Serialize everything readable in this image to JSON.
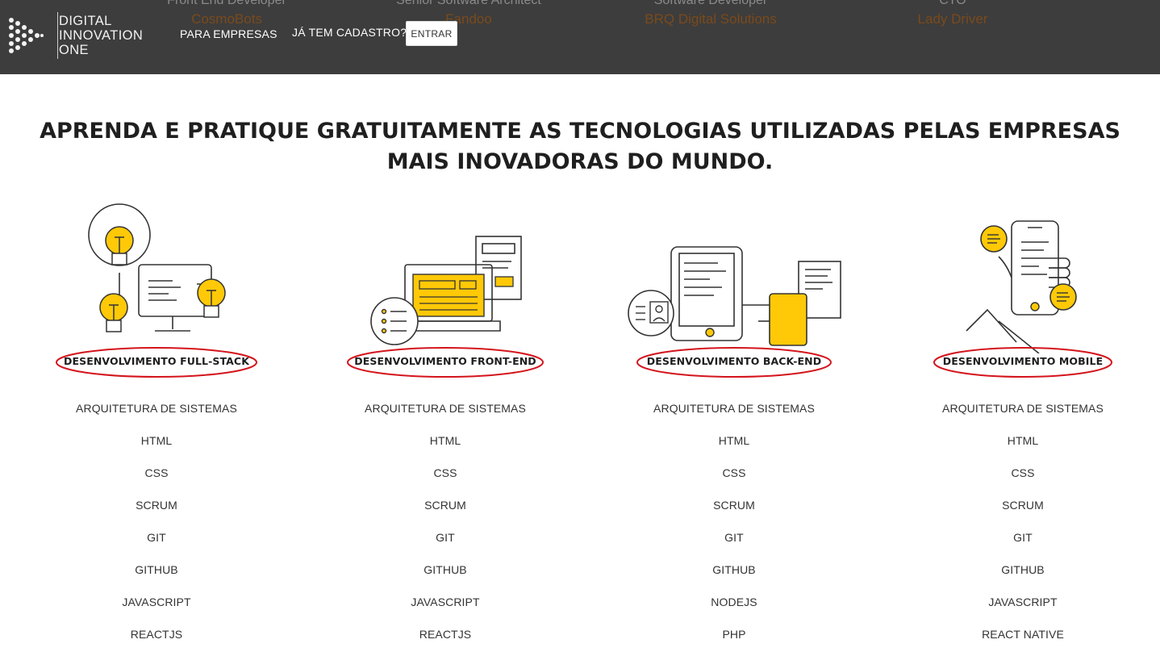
{
  "header": {
    "logo_lines": [
      "DIGITAL",
      "INNOVATION",
      "ONE"
    ],
    "nav_companies": "PARA EMPRESAS",
    "already_registered": "JÁ TEM CADASTRO?",
    "login_button": "ENTRAR",
    "background_testimonials": [
      {
        "role": "Front End Developer",
        "company": "CosmoBots"
      },
      {
        "role": "Senior Software Architect",
        "company": "Fandoo"
      },
      {
        "role": "Software Developer",
        "company": "BRQ Digital Solutions"
      },
      {
        "role": "CTO",
        "company": "Lady Driver"
      }
    ]
  },
  "headline": {
    "line1": "APRENDA E PRATIQUE GRATUITAMENTE AS TECNOLOGIAS UTILIZADAS PELAS EMPRESAS",
    "line2": "MAIS INOVADORAS DO MUNDO."
  },
  "colors": {
    "topbar": "#3d3d3d",
    "accent_yellow": "#ffc907",
    "highlight_ellipse": "#d4141c",
    "company_text": "#7a4a1c"
  },
  "tracks": [
    {
      "title": "DESENVOLVIMENTO FULL-STACK",
      "icon": "fullstack-illustration",
      "topics": [
        "ARQUITETURA DE SISTEMAS",
        "HTML",
        "CSS",
        "SCRUM",
        "GIT",
        "GITHUB",
        "JAVASCRIPT",
        "REACTJS"
      ]
    },
    {
      "title": "DESENVOLVIMENTO FRONT-END",
      "icon": "frontend-illustration",
      "topics": [
        "ARQUITETURA DE SISTEMAS",
        "HTML",
        "CSS",
        "SCRUM",
        "GIT",
        "GITHUB",
        "JAVASCRIPT",
        "REACTJS"
      ]
    },
    {
      "title": "DESENVOLVIMENTO BACK-END",
      "icon": "backend-illustration",
      "topics": [
        "ARQUITETURA DE SISTEMAS",
        "HTML",
        "CSS",
        "SCRUM",
        "GIT",
        "GITHUB",
        "NODEJS",
        "PHP"
      ]
    },
    {
      "title": "DESENVOLVIMENTO MOBILE",
      "icon": "mobile-illustration",
      "topics": [
        "ARQUITETURA DE SISTEMAS",
        "HTML",
        "CSS",
        "SCRUM",
        "GIT",
        "GITHUB",
        "JAVASCRIPT",
        "REACT NATIVE"
      ]
    }
  ]
}
